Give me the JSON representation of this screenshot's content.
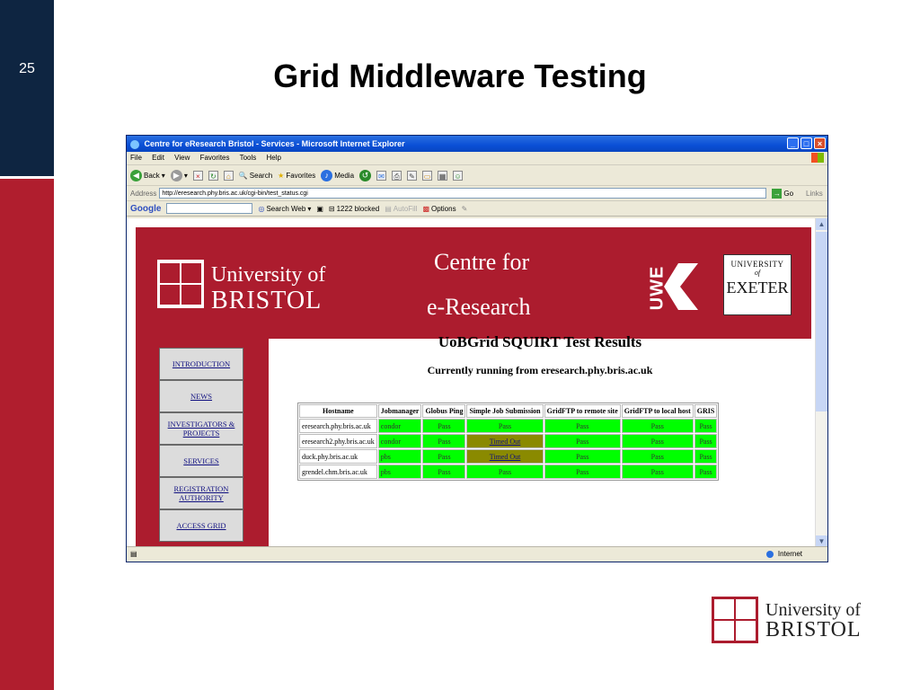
{
  "slide": {
    "number": "25",
    "title": "Grid Middleware Testing",
    "colors": {
      "navy": "#0e2541",
      "red": "#b01e2e"
    }
  },
  "browser": {
    "window_title": "Centre for eResearch Bristol - Services - Microsoft Internet Explorer",
    "menu": [
      "File",
      "Edit",
      "View",
      "Favorites",
      "Tools",
      "Help"
    ],
    "toolbar": {
      "back": "Back",
      "search": "Search",
      "favorites": "Favorites",
      "media": "Media"
    },
    "address_label": "Address",
    "url": "http://eresearch.phy.bris.ac.uk/cgi-bin/test_status.cgi",
    "go": "Go",
    "links": "Links",
    "google": {
      "logo": "Google",
      "search_web": "Search Web",
      "blocked": "1222 blocked",
      "autofill": "AutoFill",
      "options": "Options"
    },
    "status_zone": "Internet"
  },
  "page": {
    "banner": {
      "bristol_line1": "University of",
      "bristol_line2": "BRISTOL",
      "centre_line1": "Centre for",
      "centre_line2": "e-Research",
      "uwe": "UWE",
      "exeter_line1": "UNIVERSITY",
      "exeter_line2": "of",
      "exeter_line3": "EXETER"
    },
    "nav": [
      "INTRODUCTION",
      "NEWS",
      "INVESTIGATORS & PROJECTS",
      "SERVICES",
      "REGISTRATION AUTHORITY",
      "ACCESS GRID"
    ],
    "results_title": "UoBGrid SQUIRT Test Results",
    "results_subtitle": "Currently running from eresearch.phy.bris.ac.uk",
    "table": {
      "headers": [
        "Hostname",
        "Jobmanager",
        "Globus Ping",
        "Simple Job Submission",
        "GridFTP to remote site",
        "GridFTP to local host",
        "GRIS"
      ],
      "rows": [
        [
          "eresearch.phy.bris.ac.uk",
          "condor",
          "Pass",
          "Pass",
          "Pass",
          "Pass",
          "Pass"
        ],
        [
          "eresearch2.phy.bris.ac.uk",
          "condor",
          "Pass",
          "Timed Out",
          "Pass",
          "Pass",
          "Pass"
        ],
        [
          "duck.phy.bris.ac.uk",
          "pbs",
          "Pass",
          "Timed Out",
          "Pass",
          "Pass",
          "Pass"
        ],
        [
          "grendel.chm.bris.ac.uk",
          "pbs",
          "Pass",
          "Pass",
          "Pass",
          "Pass",
          "Pass"
        ]
      ],
      "colors": {
        "pass": "#00ff00",
        "timeout": "#8a8a00"
      }
    }
  },
  "footer_logo": {
    "line1": "University of",
    "line2": "BRISTOL"
  }
}
